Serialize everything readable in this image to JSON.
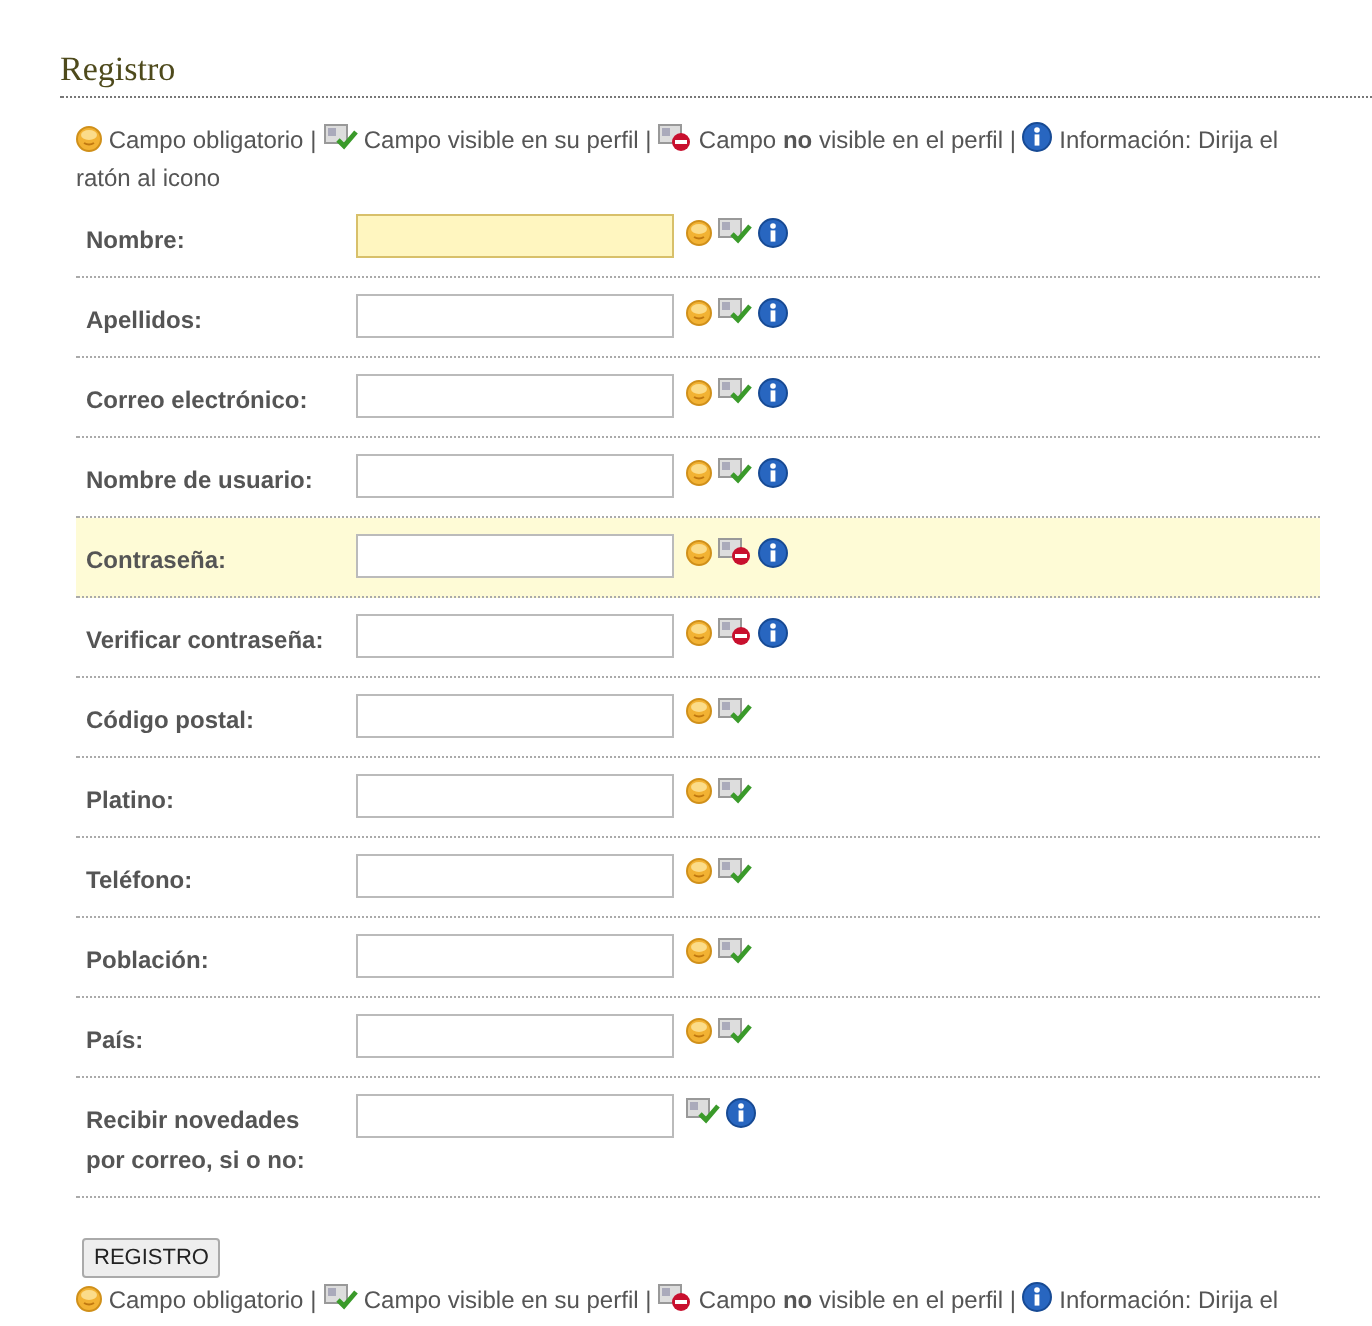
{
  "title": "Registro",
  "legend_top": [
    {
      "kind": "required",
      "text": "Campo obligatorio |"
    },
    {
      "kind": "visible",
      "text": "Campo visible en su perfil |"
    },
    {
      "kind": "hidden",
      "text": "Campo **no** visible en el perfil |"
    },
    {
      "kind": "info",
      "text": "Información: Dirija el"
    },
    {
      "kind": "plain",
      "text": "ratón al icono"
    }
  ],
  "fields": [
    {
      "label": "Nombre:",
      "focused": true,
      "highlighted": false,
      "required": true,
      "visible_in_profile": true,
      "info": true
    },
    {
      "label": "Apellidos:",
      "focused": false,
      "highlighted": false,
      "required": true,
      "visible_in_profile": true,
      "info": true
    },
    {
      "label": "Correo electrónico:",
      "focused": false,
      "highlighted": false,
      "required": true,
      "visible_in_profile": true,
      "info": true
    },
    {
      "label": "Nombre de usuario:",
      "focused": false,
      "highlighted": false,
      "required": true,
      "visible_in_profile": true,
      "info": true
    },
    {
      "label": "Contraseña:",
      "focused": false,
      "highlighted": true,
      "required": true,
      "visible_in_profile": false,
      "info": true
    },
    {
      "label": "Verificar contraseña:",
      "focused": false,
      "highlighted": false,
      "required": true,
      "visible_in_profile": false,
      "info": true
    },
    {
      "label": "Código postal:",
      "focused": false,
      "highlighted": false,
      "required": true,
      "visible_in_profile": true,
      "info": false
    },
    {
      "label": "Platino:",
      "focused": false,
      "highlighted": false,
      "required": true,
      "visible_in_profile": true,
      "info": false
    },
    {
      "label": "Teléfono:",
      "focused": false,
      "highlighted": false,
      "required": true,
      "visible_in_profile": true,
      "info": false
    },
    {
      "label": "Población:",
      "focused": false,
      "highlighted": false,
      "required": true,
      "visible_in_profile": true,
      "info": false
    },
    {
      "label": "País:",
      "focused": false,
      "highlighted": false,
      "required": true,
      "visible_in_profile": true,
      "info": false
    },
    {
      "label": "Recibir novedades por correo, si o no:",
      "focused": false,
      "highlighted": false,
      "required": false,
      "visible_in_profile": true,
      "info": true
    }
  ],
  "submit": "REGISTRO",
  "legend_bottom": [
    {
      "kind": "required",
      "text": "Campo obligatorio |"
    },
    {
      "kind": "visible",
      "text": "Campo visible en su perfil |"
    },
    {
      "kind": "hidden",
      "text": "Campo **no** visible en el perfil |"
    },
    {
      "kind": "info",
      "text": "Información: Dirija el"
    }
  ]
}
